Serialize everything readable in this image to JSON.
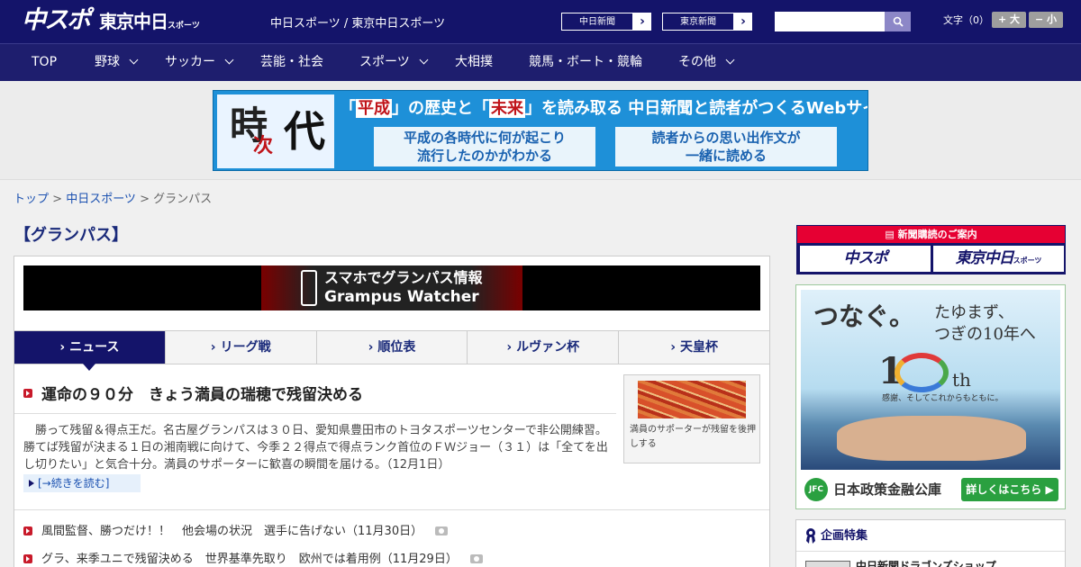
{
  "header": {
    "logo_chunichi": "中スポ",
    "logo_tokyo": "東京中日",
    "logo_tokyo_sub": "スポーツ",
    "site_name": "中日スポーツ / 東京中日スポーツ",
    "link_chunichi": "中日新聞",
    "link_tokyo": "東京新聞",
    "font_size_label": "文字（0）",
    "font_larger": "+ 大",
    "font_smaller": "− 小",
    "search_placeholder": ""
  },
  "nav": [
    {
      "label": "TOP"
    },
    {
      "label": "野球"
    },
    {
      "label": "サッカー"
    },
    {
      "label": "芸能・社会"
    },
    {
      "label": "スポーツ"
    },
    {
      "label": "大相撲"
    },
    {
      "label": "競馬・ボート・競輪"
    },
    {
      "label": "その他"
    }
  ],
  "banner": {
    "kanji_1": "時",
    "kanji_2": "次",
    "kanji_3": "代",
    "headline_pre": "「",
    "headline_em1": "平成",
    "headline_mid1": "」の歴史と「",
    "headline_em2": "未来",
    "headline_post": "」を読み取る 中日新聞と読者がつくるWebサイト",
    "sub1_line1": "平成の各時代に何が起こり",
    "sub1_line2": "流行したのかがわかる",
    "sub2_line1": "読者からの思い出作文が",
    "sub2_line2": "一緒に読める"
  },
  "breadcrumb": {
    "home": "トップ",
    "sep": " > ",
    "section": "中日スポーツ",
    "current": "グランパス"
  },
  "page_title": "【グランパス】",
  "grampus_banner": {
    "line1": "スマホでグランパス情報",
    "line2": "Grampus Watcher"
  },
  "tabs": [
    {
      "label": "ニュース"
    },
    {
      "label": "リーグ戦"
    },
    {
      "label": "順位表"
    },
    {
      "label": "ルヴァン杯"
    },
    {
      "label": "天皇杯"
    }
  ],
  "lead": {
    "title": "運命の９０分　きょう満員の瑞穂で残留決める",
    "body": "勝って残留＆得点王だ。名古屋グランパスは３０日、愛知県豊田市のトヨタスポーツセンターで非公開練習。勝てば残留が決まる１日の湘南戦に向けて、今季２２得点で得点ランク首位のＦＷジョー（３１）は「全てを出し切りたい」と気合十分。満員のサポーターに歓喜の瞬間を届ける。（12月1日）",
    "read_more": "[→続きを読む]",
    "photo_caption": "満員のサポーターが残留を後押しする"
  },
  "news_list": [
    {
      "title": "風間監督、勝つだけ！！　他会場の状況　選手に告げない（11月30日）"
    },
    {
      "title": "グラ、来季ユニで残留決める　世界基準先取り　欧州では着用例（11月29日）"
    }
  ],
  "sidebar": {
    "subscribe_head": "新聞購読のご案内",
    "subscribe_chunichi": "中スポ",
    "subscribe_tokyo": "東京中日",
    "subscribe_tokyo_sub": "スポーツ",
    "ad": {
      "line1": "つなぐ。",
      "line2": "たゆまず、",
      "line3": "つぎの10年へ",
      "big_num": "1",
      "suffix": "th",
      "tagline": "感謝、そしてこれからもともに。",
      "logo": "JFC",
      "company": "日本政策金融公庫",
      "cta": "詳しくはこちら ▶"
    },
    "special_title": "企画特集",
    "special_item": "中日新聞ドラゴンズショップ"
  },
  "colors": {
    "header_bg": "#14146a",
    "accent_red": "#c81a2a",
    "link_blue": "#1a50b0"
  }
}
